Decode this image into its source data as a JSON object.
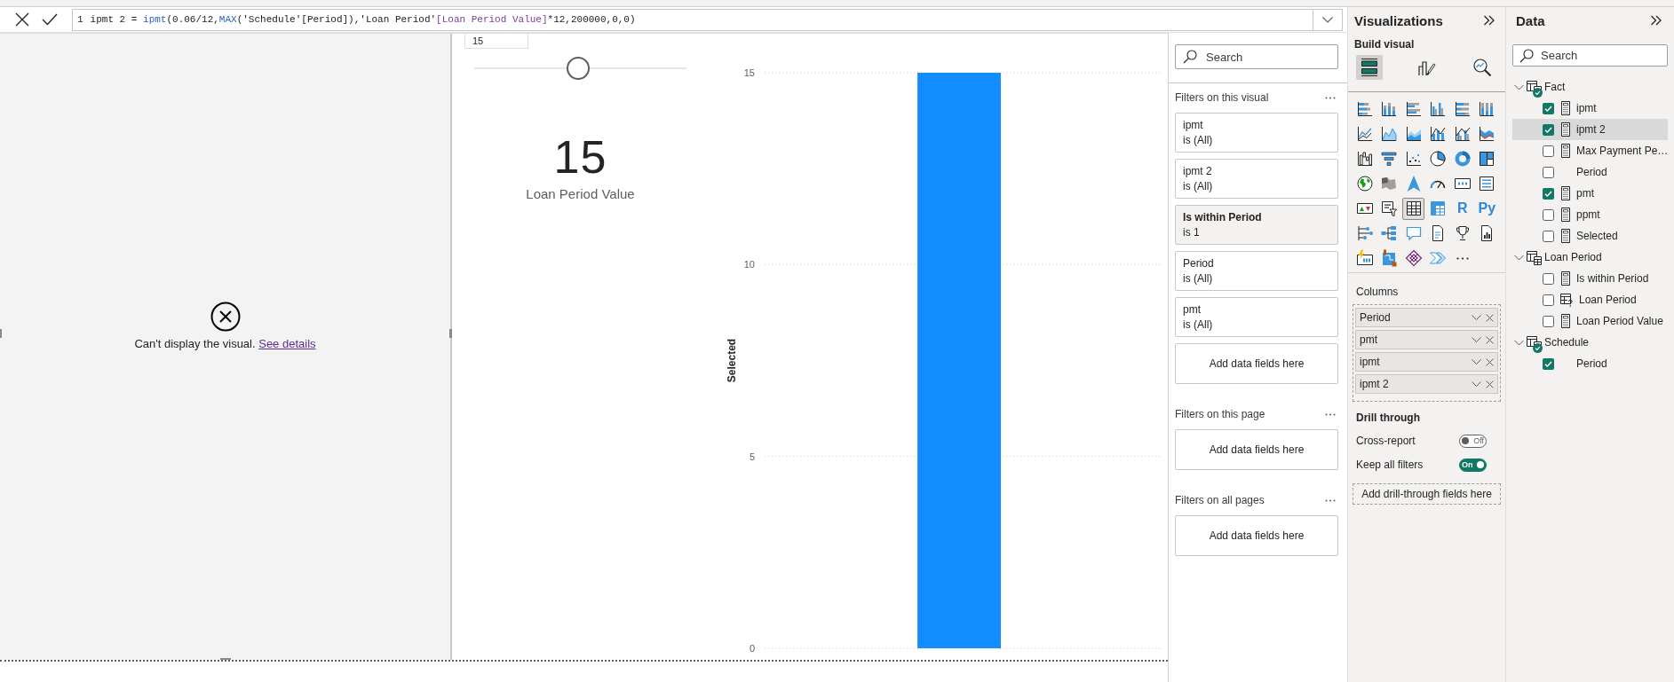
{
  "formula_bar": {
    "line_number": "1",
    "tokens": [
      {
        "text": "ipmt 2 = ",
        "kind": "plain"
      },
      {
        "text": "ipmt",
        "kind": "function"
      },
      {
        "text": "(0.06/12,",
        "kind": "plain"
      },
      {
        "text": "MAX",
        "kind": "function"
      },
      {
        "text": "('Schedule'[Period]),'Loan Period'",
        "kind": "plain"
      },
      {
        "text": "[Loan Period Value]",
        "kind": "column"
      },
      {
        "text": "*12,200000,0,0)",
        "kind": "plain"
      }
    ]
  },
  "canvas": {
    "error_visual": {
      "message": "Can't display the visual.",
      "link": "See details"
    },
    "slicer": {
      "value": "15",
      "level": 0.49
    },
    "card": {
      "value": "15",
      "label": "Loan Period Value"
    },
    "chart": {
      "chart_data": {
        "type": "bar",
        "ylabel": "Selected",
        "values": [
          15
        ],
        "yticks": [
          0,
          5,
          10,
          15
        ],
        "ylim": [
          0,
          15
        ]
      }
    }
  },
  "filters": {
    "search": {
      "placeholder": "Search"
    },
    "sections": [
      {
        "title": "Filters on this visual",
        "cards": [
          {
            "name": "ipmt",
            "condition": "is (All)",
            "applied": false
          },
          {
            "name": "ipmt 2",
            "condition": "is (All)",
            "applied": false
          },
          {
            "name": "Is within Period",
            "condition": "is 1",
            "applied": true
          },
          {
            "name": "Period",
            "condition": "is (All)",
            "applied": false
          },
          {
            "name": "pmt",
            "condition": "is (All)",
            "applied": false
          }
        ],
        "add_label": "Add data fields here"
      },
      {
        "title": "Filters on this page",
        "add_label": "Add data fields here"
      },
      {
        "title": "Filters on all pages",
        "add_label": "Add data fields here"
      }
    ]
  },
  "visualizations": {
    "title": "Visualizations",
    "subtitle": "Build visual",
    "tabs": [
      {
        "kind": "build",
        "selected": true
      },
      {
        "kind": "format",
        "selected": false
      },
      {
        "kind": "analytics",
        "selected": false
      }
    ],
    "gallery": [
      {
        "kind": "stacked-bar",
        "selected": false
      },
      {
        "kind": "stacked-column",
        "selected": false
      },
      {
        "kind": "clustered-bar",
        "selected": false
      },
      {
        "kind": "clustered-column",
        "selected": false
      },
      {
        "kind": "percent-bar",
        "selected": false
      },
      {
        "kind": "percent-column",
        "selected": false
      },
      {
        "kind": "line",
        "selected": false
      },
      {
        "kind": "area",
        "selected": false
      },
      {
        "kind": "stacked-area",
        "selected": false
      },
      {
        "kind": "line-stacked-column",
        "selected": false
      },
      {
        "kind": "line-clustered-column",
        "selected": false
      },
      {
        "kind": "ribbon",
        "selected": false
      },
      {
        "kind": "waterfall",
        "selected": false
      },
      {
        "kind": "funnel",
        "selected": false
      },
      {
        "kind": "scatter",
        "selected": false
      },
      {
        "kind": "pie",
        "selected": false
      },
      {
        "kind": "donut",
        "selected": false
      },
      {
        "kind": "treemap",
        "selected": false
      },
      {
        "kind": "globe-map",
        "selected": false
      },
      {
        "kind": "filled-map",
        "selected": false
      },
      {
        "kind": "azure-map",
        "selected": false
      },
      {
        "kind": "gauge",
        "selected": false
      },
      {
        "kind": "card",
        "selected": false
      },
      {
        "kind": "multi-row-card",
        "selected": false
      },
      {
        "kind": "kpi",
        "selected": false
      },
      {
        "kind": "slicer",
        "selected": false
      },
      {
        "kind": "table",
        "selected": true
      },
      {
        "kind": "matrix",
        "selected": false
      },
      {
        "kind": "script",
        "label": "R",
        "selected": false
      },
      {
        "kind": "script",
        "label": "Py",
        "selected": false
      },
      {
        "kind": "key-influencers",
        "selected": false
      },
      {
        "kind": "decomposition-tree",
        "selected": false
      },
      {
        "kind": "qa",
        "selected": false
      },
      {
        "kind": "narrative",
        "selected": false
      },
      {
        "kind": "goals",
        "selected": false
      },
      {
        "kind": "paginated",
        "selected": false
      },
      {
        "kind": "metric",
        "selected": false
      },
      {
        "kind": "arcgis",
        "selected": false
      },
      {
        "kind": "power-apps",
        "selected": false
      },
      {
        "kind": "power-automate",
        "selected": false
      }
    ],
    "wells": {
      "title": "Columns",
      "fields": [
        "Period",
        "pmt",
        "ipmt",
        "ipmt 2"
      ]
    },
    "drill_through": {
      "title": "Drill through",
      "options": [
        {
          "label": "Cross-report",
          "on": false,
          "state_label": "Off"
        },
        {
          "label": "Keep all filters",
          "on": true,
          "state_label": "On"
        }
      ],
      "add_label": "Add drill-through fields here"
    }
  },
  "data": {
    "title": "Data",
    "search": {
      "placeholder": "Search"
    },
    "tables": [
      {
        "name": "Fact",
        "in_use": true,
        "expanded": true,
        "fields": [
          {
            "name": "ipmt",
            "kind": "measure",
            "checked": true,
            "selected": false
          },
          {
            "name": "ipmt 2",
            "kind": "measure",
            "checked": true,
            "selected": true
          },
          {
            "name": "Max Payment Pe…",
            "kind": "measure",
            "checked": false,
            "selected": false
          },
          {
            "name": "Period",
            "kind": "column",
            "checked": false,
            "selected": false
          },
          {
            "name": "pmt",
            "kind": "measure",
            "checked": true,
            "selected": false
          },
          {
            "name": "ppmt",
            "kind": "measure",
            "checked": false,
            "selected": false
          },
          {
            "name": "Selected",
            "kind": "measure",
            "checked": false,
            "selected": false
          }
        ]
      },
      {
        "name": "Loan Period",
        "in_use": false,
        "expanded": true,
        "fields": [
          {
            "name": "Is within Period",
            "kind": "measure",
            "checked": false,
            "selected": false
          },
          {
            "name": "Loan Period",
            "kind": "parameter",
            "checked": false,
            "selected": false
          },
          {
            "name": "Loan Period Value",
            "kind": "measure",
            "checked": false,
            "selected": false
          }
        ]
      },
      {
        "name": "Schedule",
        "in_use": true,
        "expanded": true,
        "fields": [
          {
            "name": "Period",
            "kind": "column",
            "checked": true,
            "selected": false
          }
        ]
      }
    ]
  }
}
